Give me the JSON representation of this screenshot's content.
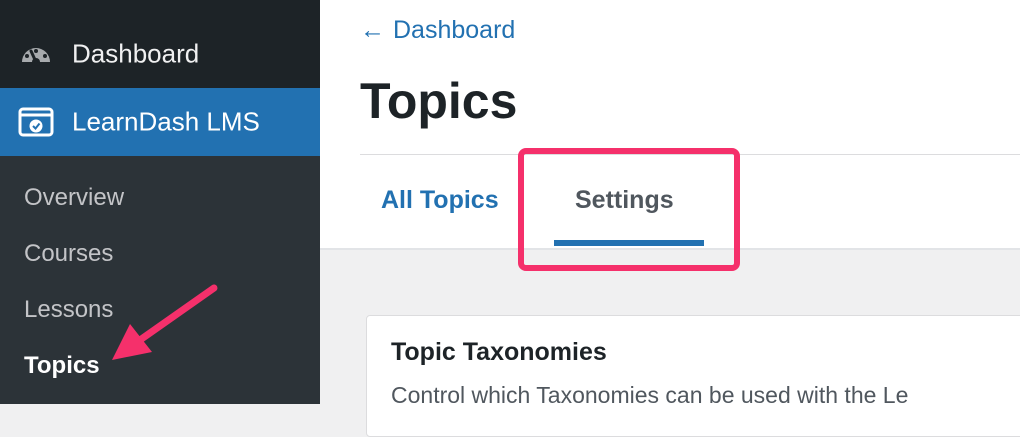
{
  "sidebar": {
    "dashboard_label": "Dashboard",
    "learndash_label": "LearnDash LMS",
    "submenu": [
      {
        "label": "Overview"
      },
      {
        "label": "Courses"
      },
      {
        "label": "Lessons"
      },
      {
        "label": "Topics"
      }
    ],
    "active_item": "Topics"
  },
  "header": {
    "back_link": "Dashboard",
    "back_arrow": "←",
    "page_title": "Topics"
  },
  "tabs": [
    {
      "label": "All Topics"
    },
    {
      "label": "Settings"
    }
  ],
  "active_tab": "Settings",
  "card": {
    "title": "Topic Taxonomies",
    "description": "Control which Taxonomies can be used with the Le"
  },
  "colors": {
    "sidebar_bg": "#1d2327",
    "submenu_bg": "#2c3338",
    "accent": "#2271b1",
    "annotation": "#f5306b"
  },
  "icons": {
    "dashboard": "gauge-icon",
    "learndash": "learndash-icon",
    "annotation_arrow": "arrow-annotation"
  }
}
